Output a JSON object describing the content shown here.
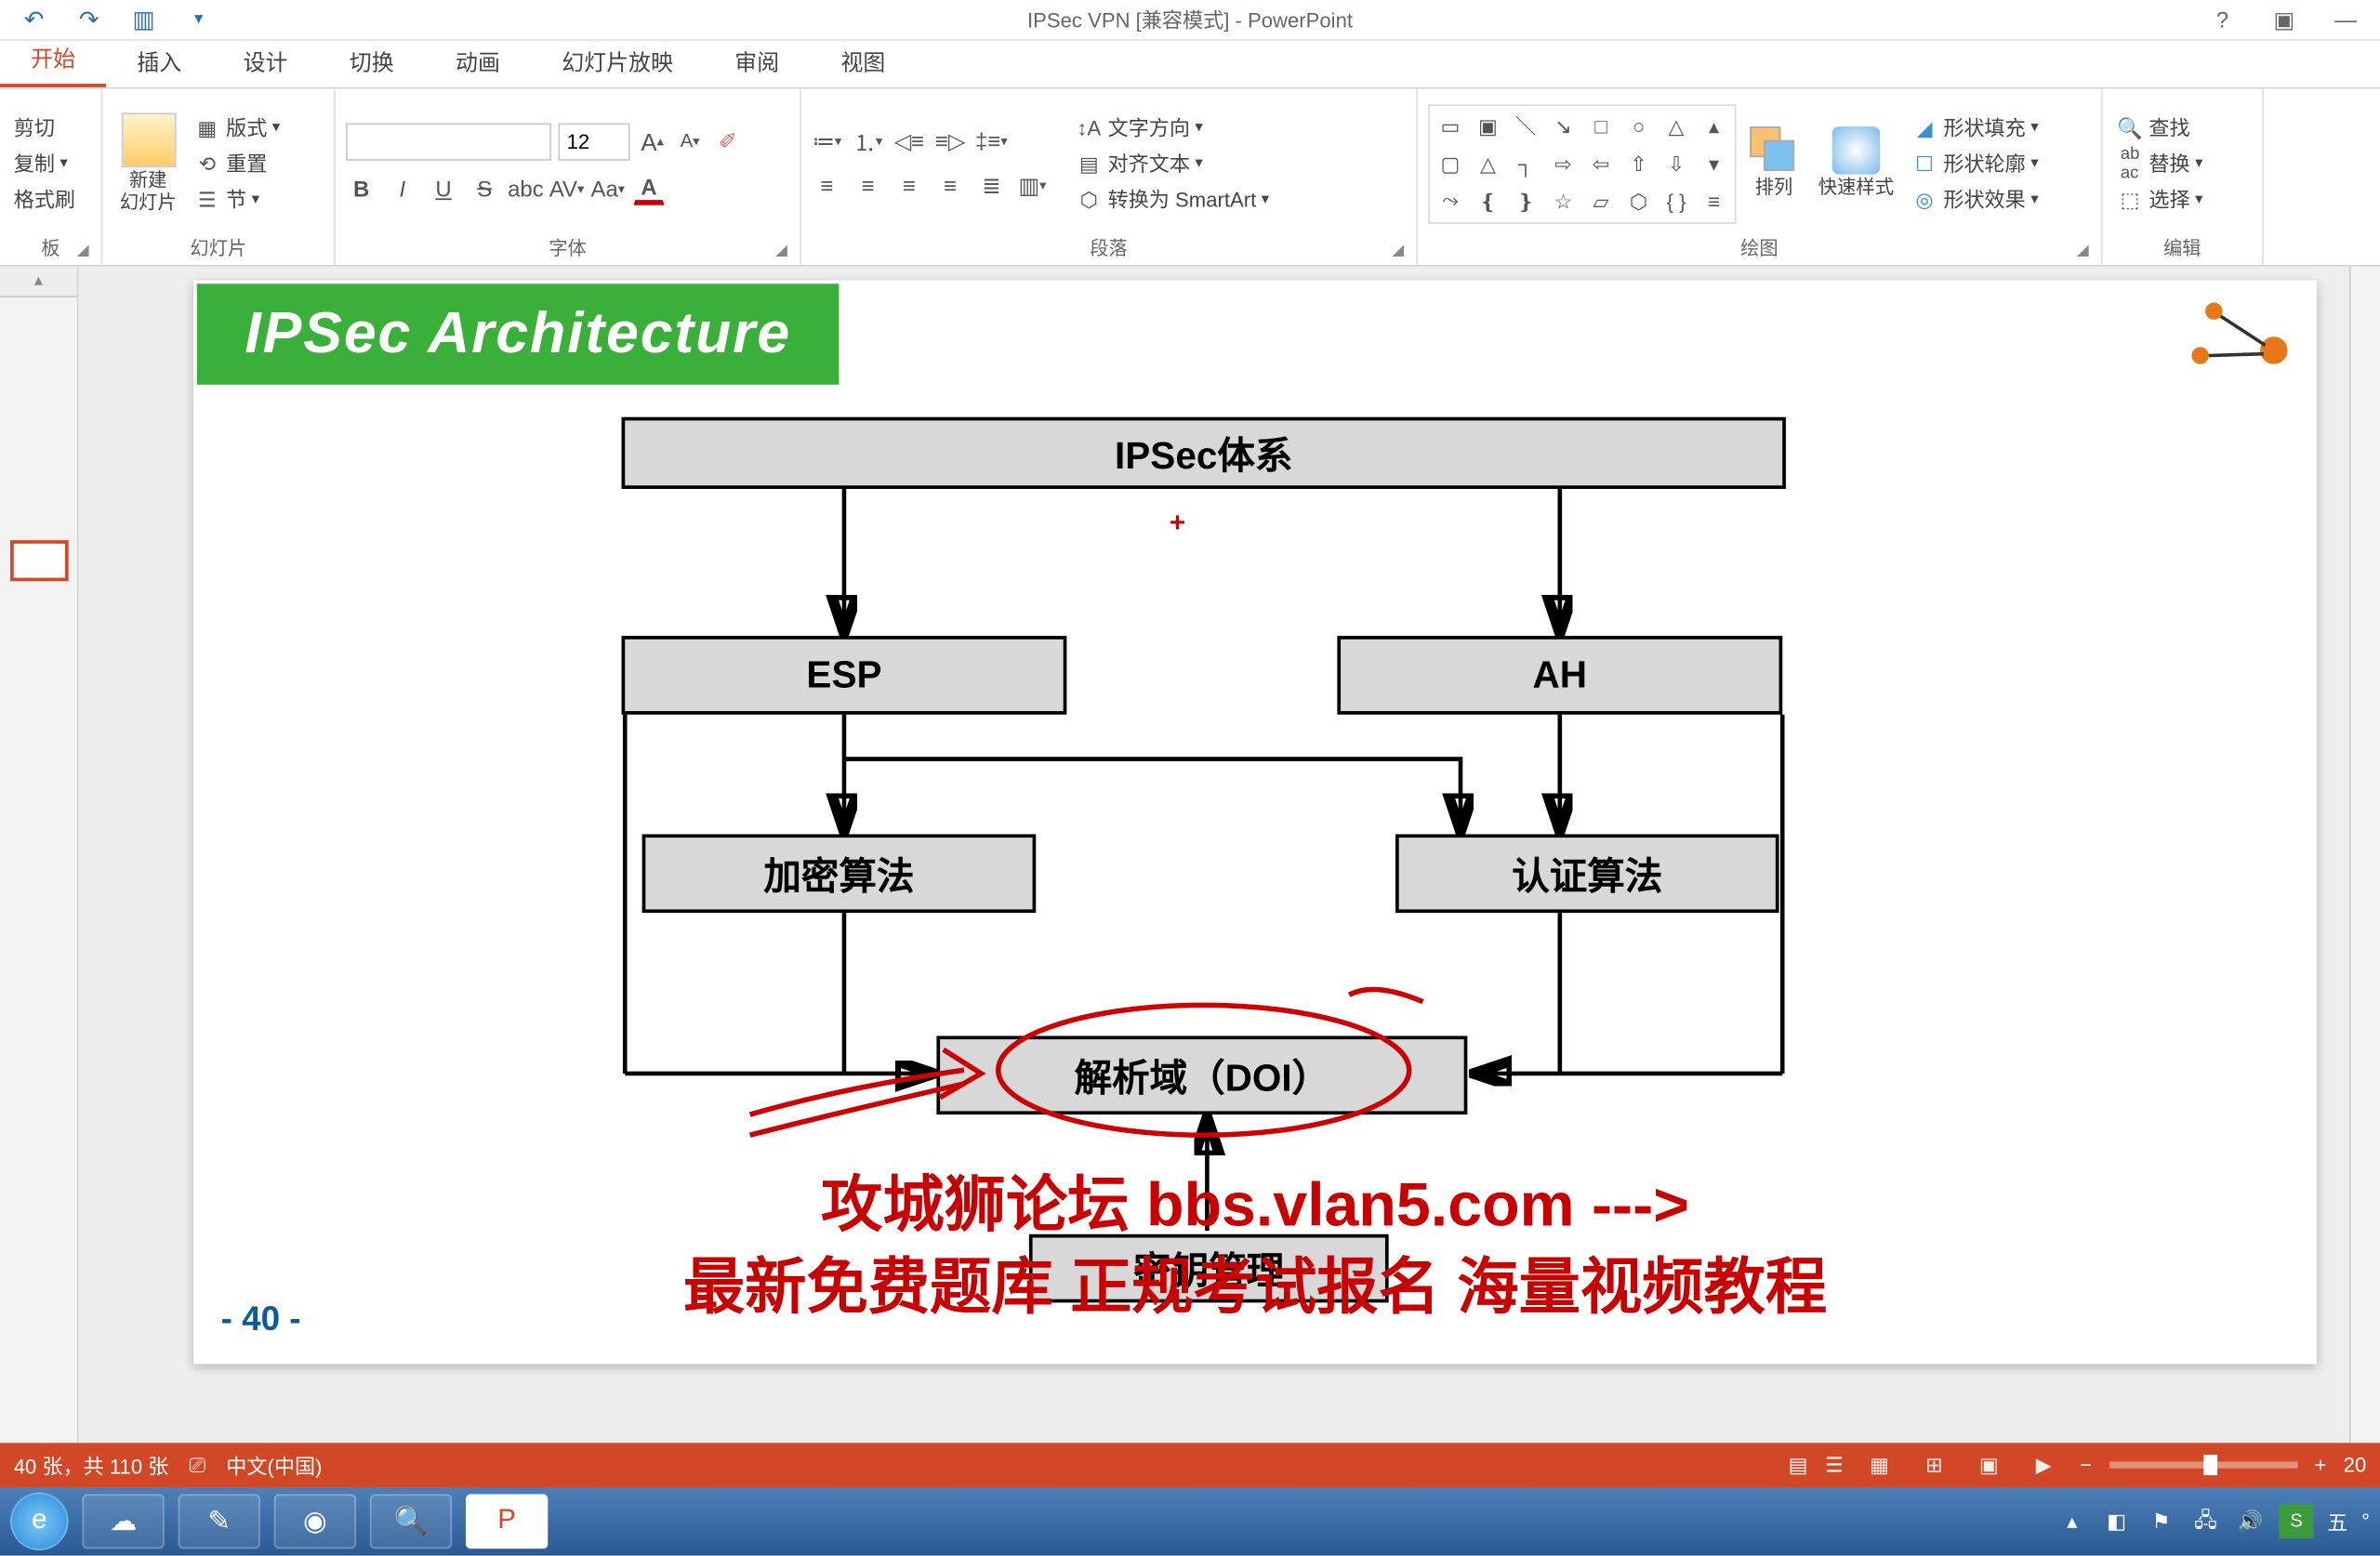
{
  "app": {
    "title": "IPSec VPN [兼容模式] - PowerPoint"
  },
  "tabs": {
    "home": "开始",
    "insert": "插入",
    "design": "设计",
    "transitions": "切换",
    "animations": "动画",
    "slideshow": "幻灯片放映",
    "review": "审阅",
    "view": "视图"
  },
  "clipboard": {
    "cut": "剪切",
    "copy": "复制",
    "formatpainter": "格式刷"
  },
  "slides": {
    "new": "新建\n幻灯片",
    "layout": "版式",
    "reset": "重置",
    "section": "节",
    "group": "幻灯片"
  },
  "font": {
    "size": "12",
    "group": "字体"
  },
  "para": {
    "textdir": "文字方向",
    "align": "对齐文本",
    "smartart": "转换为 SmartArt",
    "group": "段落"
  },
  "drawing": {
    "arrange": "排列",
    "quickstyle": "快速样式",
    "fill": "形状填充",
    "outline": "形状轮廓",
    "effects": "形状效果",
    "group": "绘图"
  },
  "editing": {
    "find": "查找",
    "replace": "替换",
    "select": "选择",
    "group": "编辑"
  },
  "slide": {
    "title": "IPSec Architecture",
    "boxes": {
      "root": "IPSec体系",
      "esp": "ESP",
      "ah": "AH",
      "enc": "加密算法",
      "auth": "认证算法",
      "doi": "解析域（DOI）",
      "keymgmt": "密钥管理"
    },
    "page": "- 40 -"
  },
  "watermark": {
    "line1": "攻城狮论坛 bbs.vlan5.com --->",
    "line2": "最新免费题库 正规考试报名 海量视频教程"
  },
  "status": {
    "slides": "40 张，共 110 张",
    "lang": "中文(中国)",
    "zoom": "20"
  },
  "tray": {
    "ime": "五",
    "clock": "°"
  }
}
